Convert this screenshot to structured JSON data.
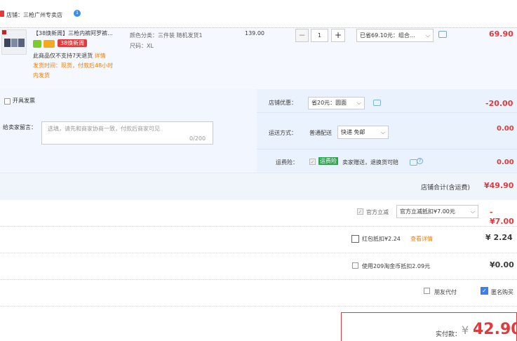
{
  "shop": {
    "name": "店铺：三枪广州专卖店",
    "badge": "1"
  },
  "item": {
    "title": "【38焕新周】三枪内裤阿罗裤...",
    "tag3": "38焕新周",
    "note_line1": "此商品仅不支持7天退货",
    "note_link1": "详情",
    "note_line2": "发货时间：现货，付款后48小时",
    "note_line3": "内发货",
    "attr1": "颜色分类：三件装 随机发货1",
    "attr2": "尺码：XL",
    "price": "139.00",
    "qty_minus": "−",
    "qty": "1",
    "qty_plus": "+",
    "promo": "已省69.10元：组合...",
    "total": "69.90"
  },
  "shipping": {
    "invoice_label": "开具发票",
    "message_label": "给卖家留言：",
    "message_placeholder": "选填，请先和商家协商一致，付款后商家可见",
    "message_count": "0/200",
    "shop_discount_label": "店铺优惠：",
    "shop_discount_select": "省20元：圆面",
    "shop_discount_amount": "-20.00",
    "delivery_label": "运送方式：",
    "delivery_type": "普通配送",
    "delivery_select": "快递 免邮",
    "delivery_amount": "0.00",
    "insurance_label": "运费险：",
    "insurance_badge": "运费险",
    "insurance_text": "卖家赠送，退换货可赔",
    "insurance_amount": "0.00",
    "insurance_info": "?"
  },
  "subtotal": {
    "label": "店铺合计(含运费)",
    "amount": "¥49.90"
  },
  "govt": {
    "label": "官方立减",
    "select": "官方立减抵扣¥7.00元",
    "amount": "-¥7.00"
  },
  "redpacket": {
    "label": "红包抵扣¥2.24",
    "link": "查看详情",
    "amount": "¥ 2.24"
  },
  "taojinbi": {
    "label": "使用209淘金币抵扣2.09元",
    "amount": "¥0.00"
  },
  "options": {
    "friend_pay": "朋友代付",
    "anonymous": "匿名购买"
  },
  "payment": {
    "label": "实付款：",
    "yen": "¥",
    "amount": "42.90"
  },
  "colors": {
    "accent": "#e4393c",
    "link": "#4a86c8",
    "warn": "#f57c00"
  }
}
